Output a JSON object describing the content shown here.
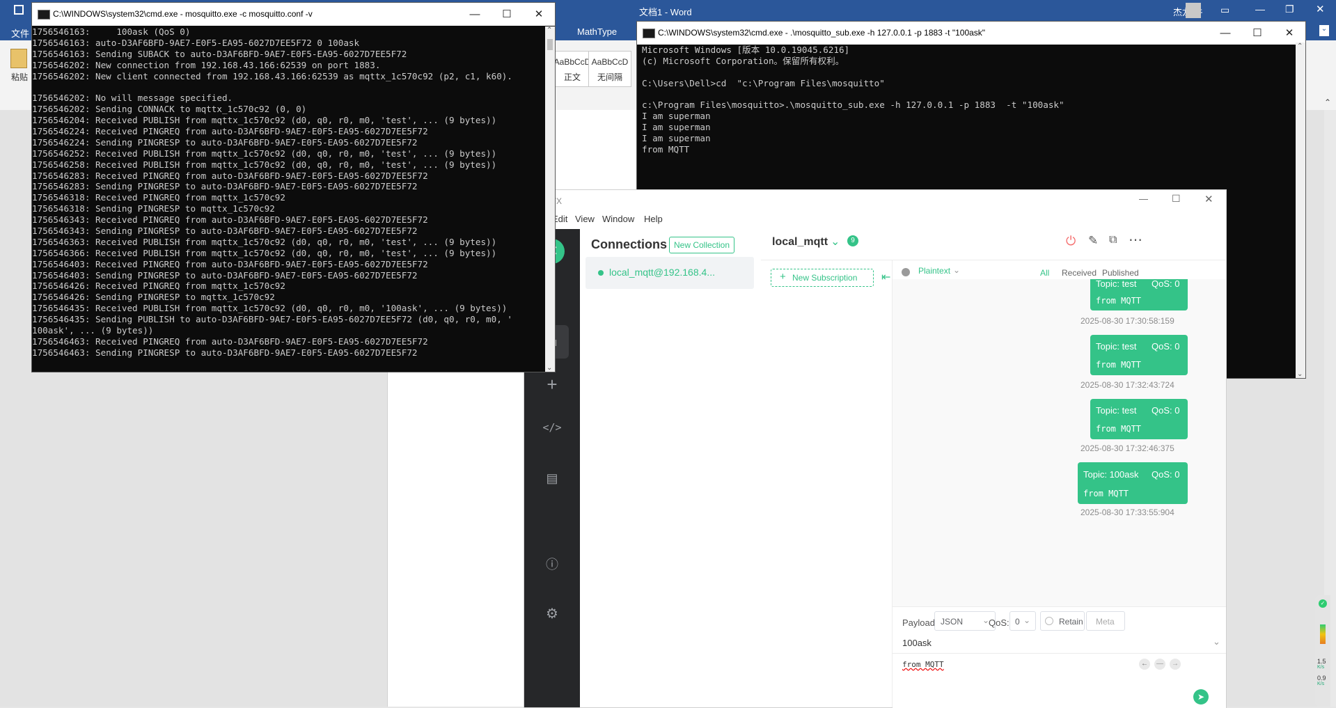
{
  "word": {
    "title": "文档1 - Word",
    "user": "杰龙 牛",
    "tab_file": "文件",
    "tab_mathtype": "MathType",
    "paste_label": "粘贴",
    "styles": [
      {
        "preview": "AaBbCcD",
        "name": "正文"
      },
      {
        "preview": "AaBbCcD",
        "name": "无间隔"
      }
    ]
  },
  "cmd1": {
    "title": "C:\\WINDOWS\\system32\\cmd.exe - mosquitto.exe  -c mosquitto.conf -v",
    "lines": [
      "1756546163:     100ask (QoS 0)",
      "1756546163: auto-D3AF6BFD-9AE7-E0F5-EA95-6027D7EE5F72 0 100ask",
      "1756546163: Sending SUBACK to auto-D3AF6BFD-9AE7-E0F5-EA95-6027D7EE5F72",
      "1756546202: New connection from 192.168.43.166:62539 on port 1883.",
      "1756546202: New client connected from 192.168.43.166:62539 as mqttx_1c570c92 (p2, c1, k60).",
      "",
      "1756546202: No will message specified.",
      "1756546202: Sending CONNACK to mqttx_1c570c92 (0, 0)",
      "1756546204: Received PUBLISH from mqttx_1c570c92 (d0, q0, r0, m0, 'test', ... (9 bytes))",
      "1756546224: Received PINGREQ from auto-D3AF6BFD-9AE7-E0F5-EA95-6027D7EE5F72",
      "1756546224: Sending PINGRESP to auto-D3AF6BFD-9AE7-E0F5-EA95-6027D7EE5F72",
      "1756546252: Received PUBLISH from mqttx_1c570c92 (d0, q0, r0, m0, 'test', ... (9 bytes))",
      "1756546258: Received PUBLISH from mqttx_1c570c92 (d0, q0, r0, m0, 'test', ... (9 bytes))",
      "1756546283: Received PINGREQ from auto-D3AF6BFD-9AE7-E0F5-EA95-6027D7EE5F72",
      "1756546283: Sending PINGRESP to auto-D3AF6BFD-9AE7-E0F5-EA95-6027D7EE5F72",
      "1756546318: Received PINGREQ from mqttx_1c570c92",
      "1756546318: Sending PINGRESP to mqttx_1c570c92",
      "1756546343: Received PINGREQ from auto-D3AF6BFD-9AE7-E0F5-EA95-6027D7EE5F72",
      "1756546343: Sending PINGRESP to auto-D3AF6BFD-9AE7-E0F5-EA95-6027D7EE5F72",
      "1756546363: Received PUBLISH from mqttx_1c570c92 (d0, q0, r0, m0, 'test', ... (9 bytes))",
      "1756546366: Received PUBLISH from mqttx_1c570c92 (d0, q0, r0, m0, 'test', ... (9 bytes))",
      "1756546403: Received PINGREQ from auto-D3AF6BFD-9AE7-E0F5-EA95-6027D7EE5F72",
      "1756546403: Sending PINGRESP to auto-D3AF6BFD-9AE7-E0F5-EA95-6027D7EE5F72",
      "1756546426: Received PINGREQ from mqttx_1c570c92",
      "1756546426: Sending PINGRESP to mqttx_1c570c92",
      "1756546435: Received PUBLISH from mqttx_1c570c92 (d0, q0, r0, m0, '100ask', ... (9 bytes))",
      "1756546435: Sending PUBLISH to auto-D3AF6BFD-9AE7-E0F5-EA95-6027D7EE5F72 (d0, q0, r0, m0, '",
      "100ask', ... (9 bytes))",
      "1756546463: Received PINGREQ from auto-D3AF6BFD-9AE7-E0F5-EA95-6027D7EE5F72",
      "1756546463: Sending PINGRESP to auto-D3AF6BFD-9AE7-E0F5-EA95-6027D7EE5F72"
    ]
  },
  "cmd2": {
    "title": "C:\\WINDOWS\\system32\\cmd.exe - .\\mosquitto_sub.exe  -h 127.0.0.1 -p 1883  -t \"100ask\"",
    "lines": [
      "Microsoft Windows [版本 10.0.19045.6216]",
      "(c) Microsoft Corporation。保留所有权利。",
      "",
      "C:\\Users\\Dell>cd  \"c:\\Program Files\\mosquitto\"",
      "",
      "c:\\Program Files\\mosquitto>.\\mosquitto_sub.exe -h 127.0.0.1 -p 1883  -t \"100ask\"",
      "I am superman",
      "I am superman",
      "I am superman",
      "from MQTT"
    ]
  },
  "mqttx": {
    "title": "MQTTX",
    "menu": [
      "Edit",
      "View",
      "Window",
      "Help"
    ],
    "connections_title": "Connections",
    "new_collection": "New Collection",
    "connection_item": "local_mqtt@192.168.4...",
    "conn_name": "local_mqtt",
    "conn_badge": "9",
    "new_subscription": "New Subscription",
    "format": "Plaintext",
    "filters": {
      "all": "All",
      "received": "Received",
      "published": "Published"
    },
    "messages": [
      {
        "topic": "Topic: test",
        "qos": "QoS: 0",
        "payload": "from MQTT",
        "time": "2025-08-30 17:30:58:159"
      },
      {
        "topic": "Topic: test",
        "qos": "QoS: 0",
        "payload": "from MQTT",
        "time": "2025-08-30 17:32:43:724"
      },
      {
        "topic": "Topic: test",
        "qos": "QoS: 0",
        "payload": "from MQTT",
        "time": "2025-08-30 17:32:46:375"
      },
      {
        "topic": "Topic: 100ask",
        "qos": "QoS: 0",
        "payload": "from MQTT",
        "time": "2025-08-30 17:33:55:904"
      }
    ],
    "payload_label": "Payload:",
    "payload_type": "JSON",
    "qos_label": "QoS:",
    "qos_value": "0",
    "retain_label": "Retain",
    "meta_label": "Meta",
    "publish_topic": "100ask",
    "publish_payload": "from MQTT"
  },
  "tray": {
    "up": "1.5",
    "up_unit": "K/s",
    "down": "0.9",
    "down_unit": "K/s"
  }
}
